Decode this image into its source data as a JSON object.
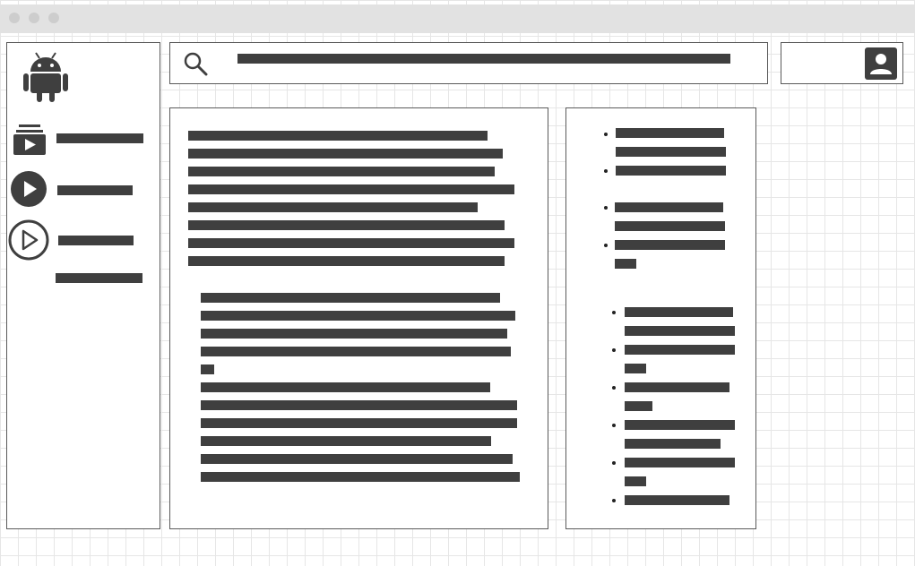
{
  "window": {
    "controls": [
      "close",
      "minimize",
      "maximize"
    ]
  },
  "icons": {
    "logo": "android-icon",
    "search": "search-icon",
    "account": "account-box-icon",
    "subscriptions": "subscriptions-icon",
    "play": "play-circle-filled-icon",
    "play_outline": "play-circle-outline-icon"
  },
  "colors": {
    "wireframe": "#3f3f3f",
    "titlebar": "#e2e2e2",
    "grid": "#e6e6e6"
  }
}
